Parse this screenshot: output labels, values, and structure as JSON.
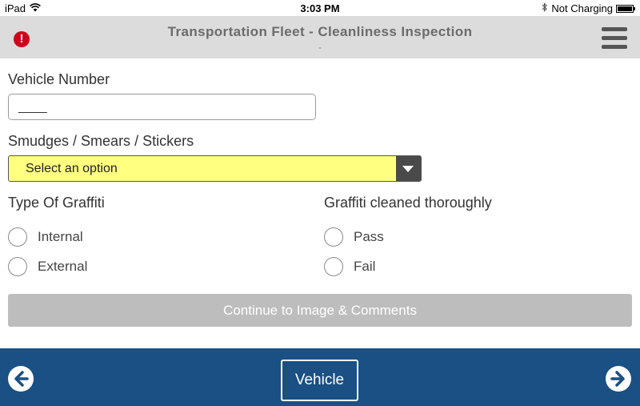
{
  "status_bar": {
    "device": "iPad",
    "time": "3:03 PM",
    "charging": "Not Charging"
  },
  "header": {
    "title": "Transportation Fleet - Cleanliness Inspection",
    "subtitle": "-",
    "alert_symbol": "!"
  },
  "form": {
    "vehicle_number": {
      "label": "Vehicle Number",
      "value": "____"
    },
    "smudges": {
      "label": "Smudges / Smears / Stickers",
      "selected": "Select an option"
    },
    "graffiti_type": {
      "label": "Type Of Graffiti",
      "options": [
        "Internal",
        "External"
      ]
    },
    "graffiti_cleaned": {
      "label": "Graffiti cleaned thoroughly",
      "options": [
        "Pass",
        "Fail"
      ]
    },
    "continue_label": "Continue to Image & Comments"
  },
  "footer": {
    "center_label": "Vehicle"
  },
  "colors": {
    "header_bg": "#dcdcdc",
    "alert": "#d0021b",
    "select_bg": "#ffff80",
    "footer_bg": "#1a5083",
    "continue_bg": "#bdbdbd"
  },
  "icons": {
    "wifi": "wifi-icon",
    "bluetooth": "bluetooth-icon",
    "battery": "battery-icon",
    "alert": "alert-icon",
    "menu": "hamburger-menu-icon",
    "back": "arrow-left-circle-icon",
    "forward": "arrow-right-circle-icon",
    "dropdown": "chevron-down-icon"
  }
}
